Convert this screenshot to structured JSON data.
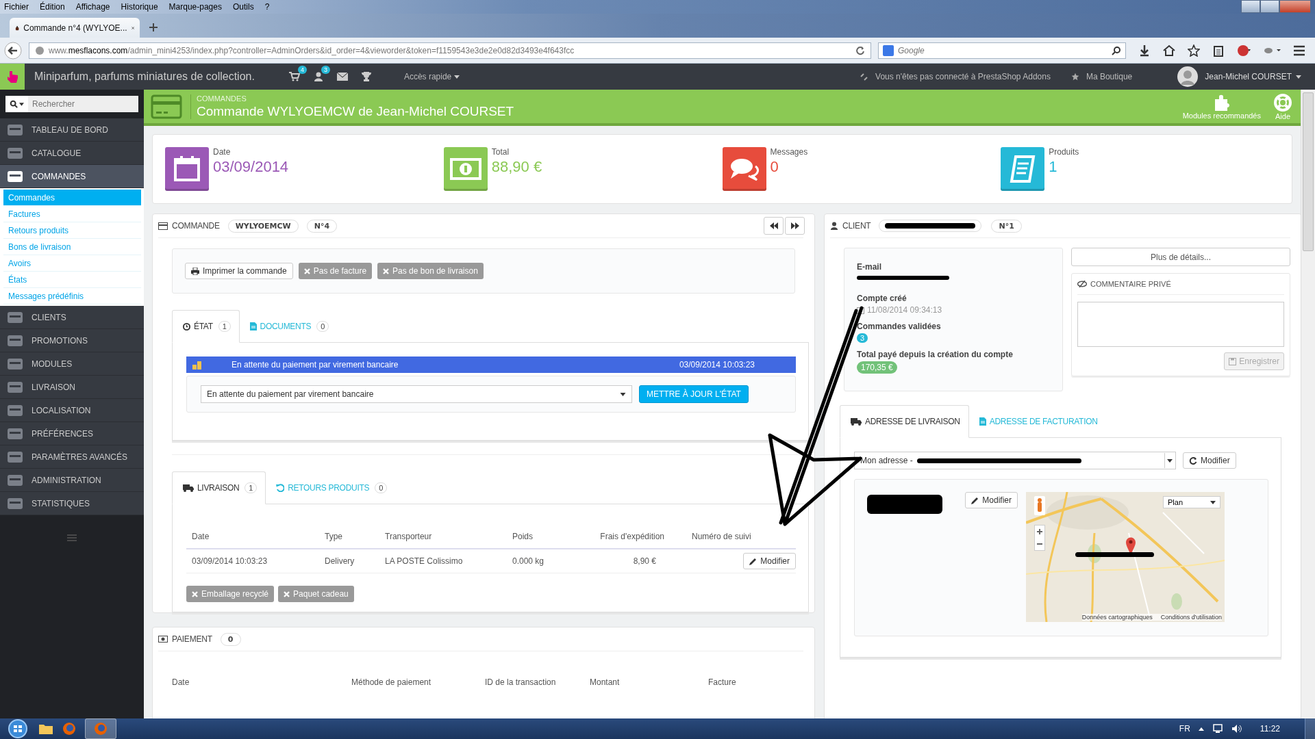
{
  "browser": {
    "menu": [
      "Fichier",
      "Édition",
      "Affichage",
      "Historique",
      "Marque-pages",
      "Outils",
      "?"
    ],
    "tab_title": "Commande n°4 (WYLYOE...",
    "url": {
      "host_prefix": "www.",
      "host": "mesflacons.com",
      "path": "/admin_mini4253/index.php?controller=AdminOrders&id_order=4&vieworder&token=f1159543e3de2e0d82d3493e4f643fcc"
    },
    "search_placeholder": "Google"
  },
  "admin_bar": {
    "shop_name": "Miniparfum, parfums miniatures de collection.",
    "notifications": [
      {
        "count": "4"
      },
      {
        "count": "3"
      }
    ],
    "quick_access": "Accès rapide",
    "addons": "Vous n'êtes pas connecté à PrestaShop Addons",
    "shop_link": "Ma Boutique",
    "user": "Jean-Michel COURSET"
  },
  "sidebar": {
    "search_placeholder": "Rechercher",
    "items": [
      {
        "label": "TABLEAU DE BORD",
        "selected": false
      },
      {
        "label": "CATALOGUE",
        "selected": false
      },
      {
        "label": "COMMANDES",
        "selected": true,
        "children": [
          {
            "label": "Commandes",
            "selected": true
          },
          {
            "label": "Factures",
            "selected": false
          },
          {
            "label": "Retours produits",
            "selected": false
          },
          {
            "label": "Bons de livraison",
            "selected": false
          },
          {
            "label": "Avoirs",
            "selected": false
          },
          {
            "label": "États",
            "selected": false
          },
          {
            "label": "Messages prédéfinis",
            "selected": false
          }
        ]
      },
      {
        "label": "CLIENTS",
        "selected": false
      },
      {
        "label": "PROMOTIONS",
        "selected": false
      },
      {
        "label": "MODULES",
        "selected": false
      },
      {
        "label": "LIVRAISON",
        "selected": false
      },
      {
        "label": "LOCALISATION",
        "selected": false
      },
      {
        "label": "PRÉFÉRENCES",
        "selected": false
      },
      {
        "label": "PARAMÈTRES AVANCÉS",
        "selected": false
      },
      {
        "label": "ADMINISTRATION",
        "selected": false
      },
      {
        "label": "STATISTIQUES",
        "selected": false
      }
    ]
  },
  "page_header": {
    "breadcrumb": "COMMANDES",
    "title": "Commande WYLYOEMCW de Jean-Michel COURSET",
    "toolbar": [
      "Modules recommandés",
      "Aide"
    ]
  },
  "kpis": [
    {
      "label": "Date",
      "value": "03/09/2014",
      "color": "#9b59b6"
    },
    {
      "label": "Total",
      "value": "88,90 €",
      "color": "#8bc954"
    },
    {
      "label": "Messages",
      "value": "0",
      "color": "#e74c3c"
    },
    {
      "label": "Produits",
      "value": "1",
      "color": "#25b9d7"
    }
  ],
  "order": {
    "title": "COMMANDE",
    "reference": "WYLYOEMCW",
    "number": "N°4",
    "actions": [
      {
        "label": "Imprimer la commande",
        "kind": "print"
      },
      {
        "label": "Pas de facture",
        "kind": "missing"
      },
      {
        "label": "Pas de bon de livraison",
        "kind": "missing"
      }
    ],
    "status_tabs": [
      {
        "label": "ÉTAT",
        "count": "1",
        "selected": true
      },
      {
        "label": "DOCUMENTS",
        "count": "0",
        "selected": false
      }
    ],
    "history": [
      {
        "status": "En attente du paiement par virement bancaire",
        "date": "03/09/2014 10:03:23",
        "color": "#4169e1"
      }
    ],
    "status_select": "En attente du paiement par virement bancaire",
    "update_button": "METTRE À JOUR L'ÉTAT",
    "shipping_tabs": [
      {
        "label": "LIVRAISON",
        "count": "1",
        "selected": true
      },
      {
        "label": "RETOURS PRODUITS",
        "count": "0",
        "selected": false
      }
    ],
    "shipping_table": {
      "columns": [
        "Date",
        "Type",
        "Transporteur",
        "Poids",
        "Frais d'expédition",
        "Numéro de suivi"
      ],
      "rows": [
        {
          "date": "03/09/2014 10:03:23",
          "type": "Delivery",
          "carrier": "LA POSTE Colissimo",
          "weight": "0.000 kg",
          "cost": "8,90 €",
          "action": "Modifier"
        }
      ]
    },
    "options": [
      "Emballage recyclé",
      "Paquet cadeau"
    ]
  },
  "payment": {
    "title": "PAIEMENT",
    "count": "0",
    "columns": [
      "Date",
      "Méthode de paiement",
      "ID de la transaction",
      "Montant",
      "Facture"
    ]
  },
  "customer": {
    "title": "CLIENT",
    "number": "N°1",
    "email_label": "E-mail",
    "created_label": "Compte créé",
    "created": "11/08/2014 09:34:13",
    "orders_label": "Commandes validées",
    "orders": "3",
    "total_label": "Total payé depuis la création du compte",
    "total": "170,35 €",
    "details_button": "Plus de détails...",
    "comment_title": "COMMENTAIRE PRIVÉ",
    "save_button": {
      "label": "Enregistrer",
      "disabled": true
    },
    "address_tabs": [
      {
        "label": "ADRESSE DE LIVRAISON",
        "selected": true
      },
      {
        "label": "ADRESSE DE FACTURATION",
        "selected": false
      }
    ],
    "address_select": "Mon adresse -",
    "change_button": "Modifier",
    "edit_button": "Modifier",
    "map": {
      "kind": "picture",
      "type_select": "Plan",
      "attribution": [
        "Données cartographiques",
        "Conditions d'utilisation"
      ]
    }
  },
  "taskbar": {
    "language": "FR",
    "time": "11:22"
  }
}
